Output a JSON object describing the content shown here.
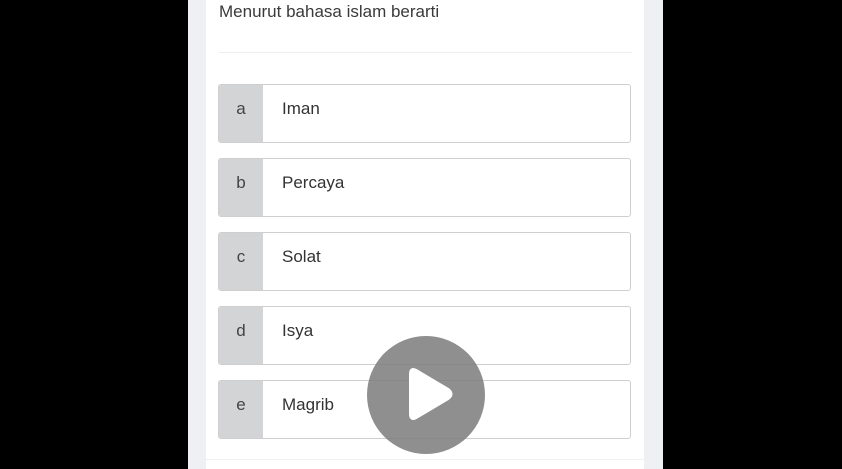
{
  "quiz": {
    "question": "Menurut bahasa islam berarti",
    "options": [
      {
        "letter": "a",
        "text": "Iman"
      },
      {
        "letter": "b",
        "text": "Percaya"
      },
      {
        "letter": "c",
        "text": "Solat"
      },
      {
        "letter": "d",
        "text": "Isya"
      },
      {
        "letter": "e",
        "text": "Magrib"
      }
    ]
  },
  "video_overlay": {
    "icon": "play-icon",
    "button_color": "#808080"
  }
}
